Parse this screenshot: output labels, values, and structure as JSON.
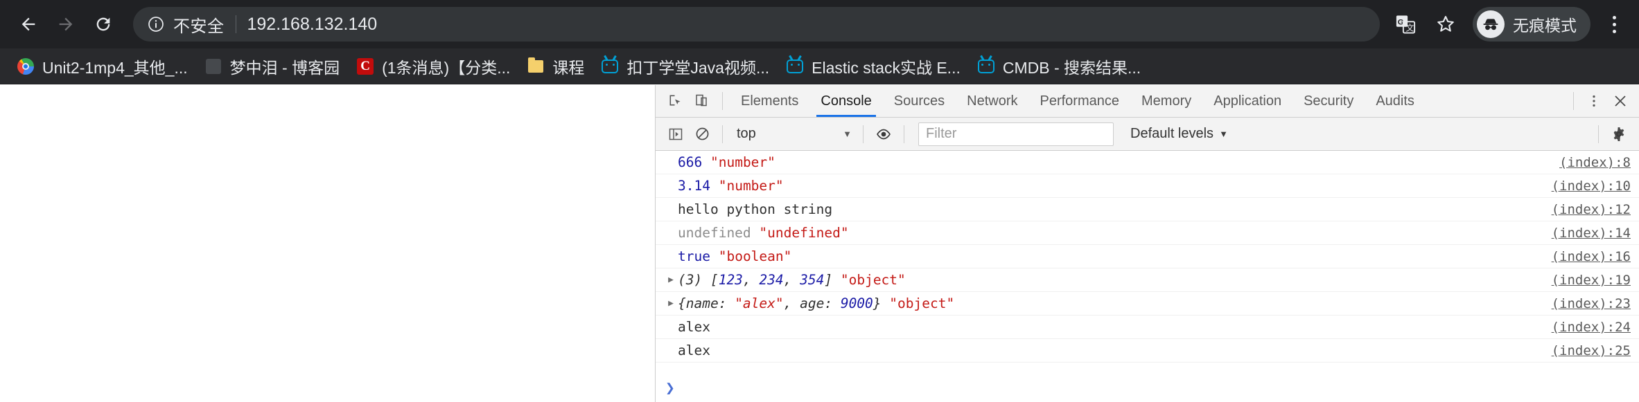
{
  "browser": {
    "nav": {
      "back_label": "Back",
      "forward_label": "Forward",
      "reload_label": "Reload"
    },
    "omnibox": {
      "security_icon": "info-circle-icon",
      "security_label": "不安全",
      "url": "192.168.132.140"
    },
    "actions": {
      "translate_label": "Translate",
      "bookmark_label": "Bookmark this page",
      "incognito_label": "无痕模式",
      "menu_label": "Customize and control Google Chrome"
    },
    "bookmarks": [
      {
        "icon": "chrome-favicon",
        "label": "Unit2-1mp4_其他_..."
      },
      {
        "icon": "blank-favicon",
        "label": "梦中泪 - 博客园"
      },
      {
        "icon": "csdn-favicon",
        "label": "(1条消息)【分类..."
      },
      {
        "icon": "folder-favicon",
        "label": "课程"
      },
      {
        "icon": "bilibili-favicon",
        "label": "扣丁学堂Java视频..."
      },
      {
        "icon": "bilibili-favicon",
        "label": "Elastic stack实战 E..."
      },
      {
        "icon": "bilibili-favicon",
        "label": "CMDB - 搜索结果..."
      }
    ]
  },
  "devtools": {
    "left_icons": [
      {
        "name": "inspect-element-icon",
        "label": "Inspect element"
      },
      {
        "name": "device-toolbar-icon",
        "label": "Toggle device toolbar"
      }
    ],
    "tabs": [
      {
        "label": "Elements",
        "active": false
      },
      {
        "label": "Console",
        "active": true
      },
      {
        "label": "Sources",
        "active": false
      },
      {
        "label": "Network",
        "active": false
      },
      {
        "label": "Performance",
        "active": false
      },
      {
        "label": "Memory",
        "active": false
      },
      {
        "label": "Application",
        "active": false
      },
      {
        "label": "Security",
        "active": false
      },
      {
        "label": "Audits",
        "active": false
      }
    ],
    "right_icons": [
      {
        "name": "more-options-icon",
        "label": "More options"
      },
      {
        "name": "close-icon",
        "label": "Close DevTools"
      }
    ],
    "filterbar": {
      "sidebar_toggle_label": "Show console sidebar",
      "clear_label": "Clear console",
      "context": "top",
      "context_caret": "▼",
      "eye_label": "Create live expression",
      "filter_placeholder": "Filter",
      "filter_value": "",
      "levels": "Default levels",
      "levels_caret": "▼",
      "settings_label": "Console settings"
    },
    "messages": [
      {
        "expandable": false,
        "source": "(index):8",
        "tokens": [
          {
            "text": "666",
            "kind": "num"
          },
          {
            "text": " ",
            "kind": "plain"
          },
          {
            "text": "\"number\"",
            "kind": "str"
          }
        ]
      },
      {
        "expandable": false,
        "source": "(index):10",
        "tokens": [
          {
            "text": "3.14",
            "kind": "num"
          },
          {
            "text": " ",
            "kind": "plain"
          },
          {
            "text": "\"number\"",
            "kind": "str"
          }
        ]
      },
      {
        "expandable": false,
        "source": "(index):12",
        "tokens": [
          {
            "text": "hello python string",
            "kind": "plain"
          }
        ]
      },
      {
        "expandable": false,
        "source": "(index):14",
        "tokens": [
          {
            "text": "undefined",
            "kind": "undef"
          },
          {
            "text": " ",
            "kind": "plain"
          },
          {
            "text": "\"undefined\"",
            "kind": "str"
          }
        ]
      },
      {
        "expandable": false,
        "source": "(index):16",
        "tokens": [
          {
            "text": "true",
            "kind": "bool"
          },
          {
            "text": " ",
            "kind": "plain"
          },
          {
            "text": "\"boolean\"",
            "kind": "str"
          }
        ]
      },
      {
        "expandable": true,
        "source": "(index):19",
        "tokens": [
          {
            "text": "(3) [",
            "kind": "obj"
          },
          {
            "text": "123",
            "kind": "objnum"
          },
          {
            "text": ", ",
            "kind": "obj"
          },
          {
            "text": "234",
            "kind": "objnum"
          },
          {
            "text": ", ",
            "kind": "obj"
          },
          {
            "text": "354",
            "kind": "objnum"
          },
          {
            "text": "] ",
            "kind": "obj"
          },
          {
            "text": "\"object\"",
            "kind": "str"
          }
        ]
      },
      {
        "expandable": true,
        "source": "(index):23",
        "tokens": [
          {
            "text": "{name: ",
            "kind": "obj"
          },
          {
            "text": "\"alex\"",
            "kind": "objstr"
          },
          {
            "text": ", age: ",
            "kind": "obj"
          },
          {
            "text": "9000",
            "kind": "objnum"
          },
          {
            "text": "} ",
            "kind": "obj"
          },
          {
            "text": "\"object\"",
            "kind": "str"
          }
        ]
      },
      {
        "expandable": false,
        "source": "(index):24",
        "tokens": [
          {
            "text": "alex",
            "kind": "plain"
          }
        ]
      },
      {
        "expandable": false,
        "source": "(index):25",
        "tokens": [
          {
            "text": "alex",
            "kind": "plain"
          }
        ]
      }
    ],
    "prompt": {
      "caret": "❯",
      "value": ""
    }
  },
  "colors": {
    "chrome_toolbar": "#202124",
    "bookmarks_bar": "#292a2d",
    "omnibox": "#333639",
    "devtools_header": "#f3f3f3",
    "active_tab_underline": "#1a73e8",
    "number_token": "#1a1aa6",
    "string_token": "#c41a16",
    "undefined_token": "#8c8c8c"
  }
}
